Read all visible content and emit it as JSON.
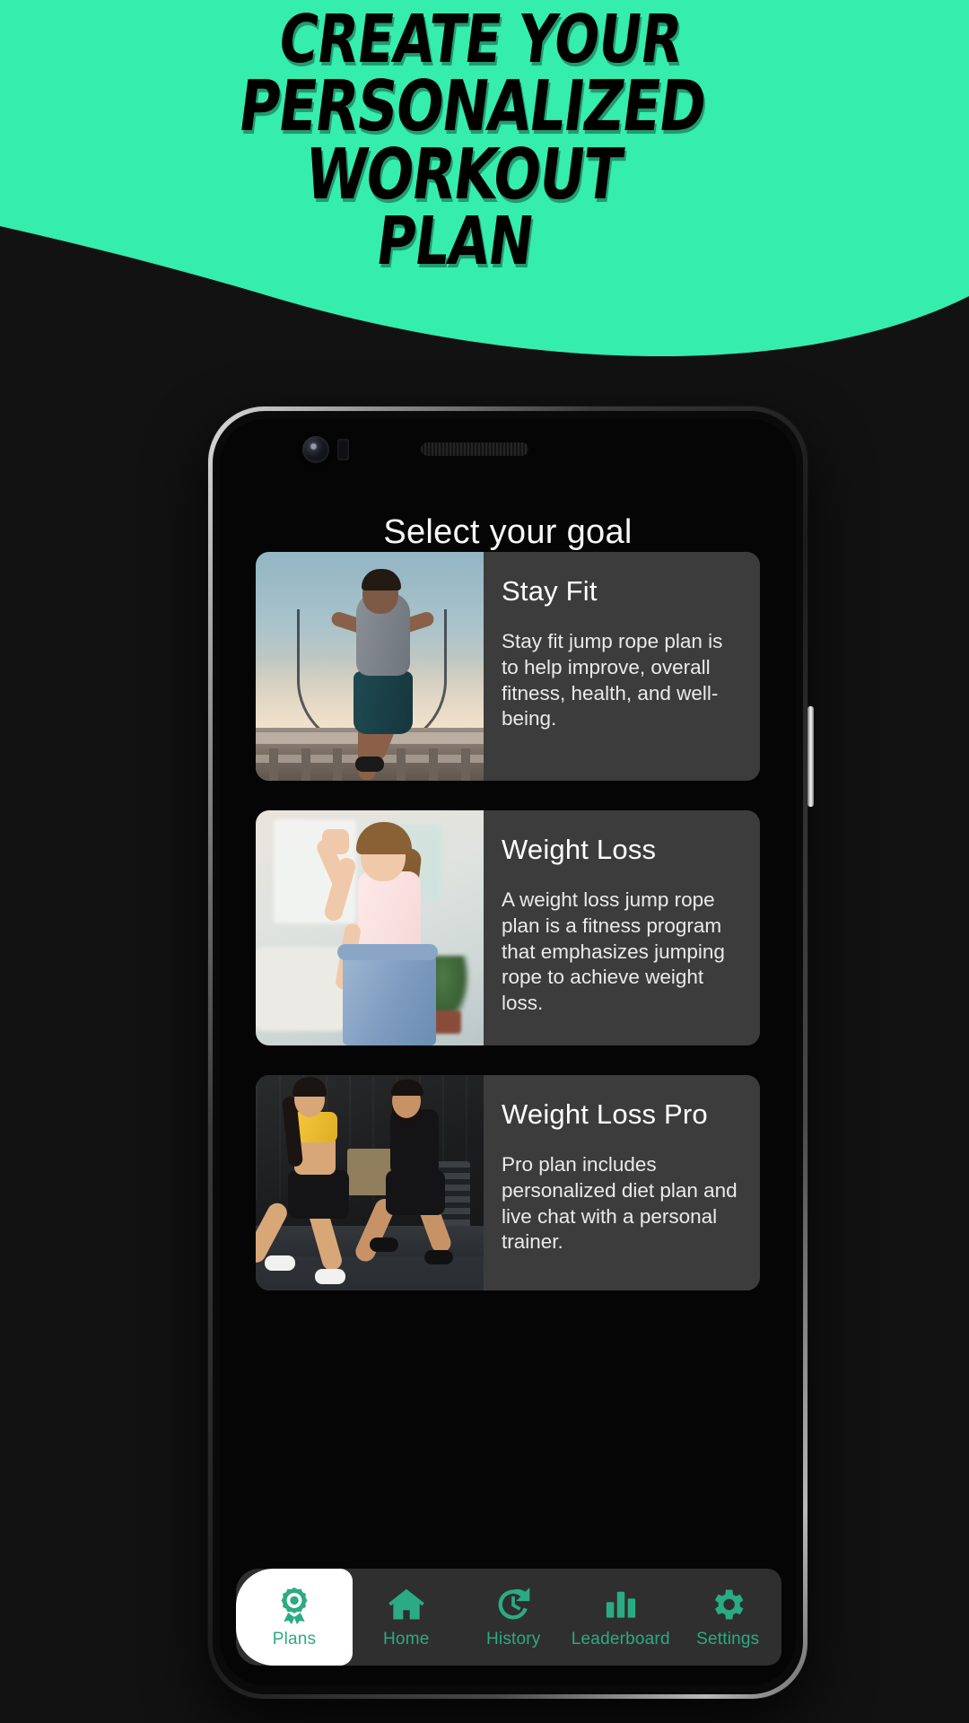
{
  "banner": {
    "headline_line1": "CREATE YOUR",
    "headline_line2": "PERSONALIZED WORKOUT",
    "headline_line3": "PLAN",
    "background_color": "#35EDAD",
    "text_color": "#000000"
  },
  "page_background": "#121212",
  "app": {
    "title": "Select your goal",
    "accent_color": "#2BAB83",
    "card_background": "#3C3C3C",
    "screen_background": "#050505",
    "cards": [
      {
        "title": "Stay Fit",
        "description": "Stay fit jump rope plan is to help improve, overall fitness, health, and well-being.",
        "image_alt": "man-skipping-rope-outdoors"
      },
      {
        "title": "Weight Loss",
        "description": "A weight loss jump rope plan is a fitness program that emphasizes jumping rope to achieve weight loss.",
        "image_alt": "woman-in-oversized-jeans-flexing"
      },
      {
        "title": "Weight Loss Pro",
        "description": "Pro plan includes personalized diet plan and live chat with a personal trainer.",
        "image_alt": "two-athletes-lunging-in-gym"
      }
    ],
    "nav": {
      "items": [
        {
          "label": "Plans",
          "icon": "award-medal-icon",
          "active": true
        },
        {
          "label": "Home",
          "icon": "home-icon",
          "active": false
        },
        {
          "label": "History",
          "icon": "history-clock-icon",
          "active": false
        },
        {
          "label": "Leaderboard",
          "icon": "bar-chart-icon",
          "active": false
        },
        {
          "label": "Settings",
          "icon": "gear-icon",
          "active": false
        }
      ],
      "active_background": "#FFFFFF",
      "background": "#2F2F2F"
    }
  }
}
